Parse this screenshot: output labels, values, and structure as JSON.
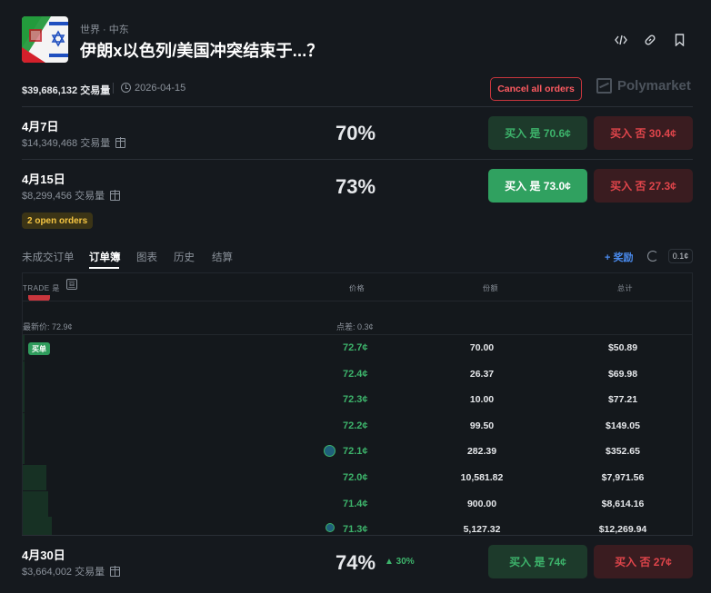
{
  "header": {
    "breadcrumb": "世界 · 中东",
    "title": "伊朗x以色列/美国冲突结束于...？",
    "volume": "$39,686,132 交易量",
    "date": "2026-04-15",
    "cancel_all_label": "Cancel all orders",
    "brand": "Polymarket"
  },
  "markets": [
    {
      "date": "4月7日",
      "volume": "$14,349,468 交易量",
      "percent": "70%",
      "yes_label": "买入 是 70.6¢",
      "no_label": "买入 否 30.4¢"
    },
    {
      "date": "4月15日",
      "volume": "$8,299,456 交易量",
      "percent": "73%",
      "yes_label": "买入 是 73.0¢",
      "no_label": "买入 否 27.3¢",
      "open_orders": "2 open orders"
    },
    {
      "date": "4月30日",
      "volume": "$3,664,002 交易量",
      "percent": "74%",
      "delta": "▲ 30%",
      "yes_label": "买入 是 74¢",
      "no_label": "买入 否 27¢"
    }
  ],
  "tabs": [
    "未成交订单",
    "订单簿",
    "图表",
    "历史",
    "结算"
  ],
  "active_tab": "订单簿",
  "reward_label": "+ 奖励",
  "tick_size": "0.1¢",
  "orderbook": {
    "trade_label": "TRADE 是",
    "trade_icon_glyph": "亘",
    "col_price": "价格",
    "col_shares": "份额",
    "col_total": "总计",
    "last_price": "最新价: 72.9¢",
    "spread": "点差: 0.3¢",
    "bid_badge": "买单",
    "bids": [
      {
        "price": "72.7¢",
        "shares": "70.00",
        "total": "$50.89",
        "depth": 0.005
      },
      {
        "price": "72.4¢",
        "shares": "26.37",
        "total": "$69.98",
        "depth": 0.007
      },
      {
        "price": "72.3¢",
        "shares": "10.00",
        "total": "$77.21",
        "depth": 0.008
      },
      {
        "price": "72.2¢",
        "shares": "99.50",
        "total": "$149.05",
        "depth": 0.015
      },
      {
        "price": "72.1¢",
        "shares": "282.39",
        "total": "$352.65",
        "depth": 0.035,
        "my_order": true
      },
      {
        "price": "72.0¢",
        "shares": "10,581.82",
        "total": "$7,971.56",
        "depth": 0.8
      },
      {
        "price": "71.4¢",
        "shares": "900.00",
        "total": "$8,614.16",
        "depth": 0.86
      },
      {
        "price": "71.3¢",
        "shares": "5,127.32",
        "total": "$12,269.94",
        "depth": 1.0,
        "my_order": true
      }
    ]
  },
  "colors": {
    "background": "#15191e",
    "yes_green": "#3db36b",
    "no_red": "#e0454b",
    "accent_blue": "#4a8cf0",
    "badge_yellow": "#f5c542"
  }
}
